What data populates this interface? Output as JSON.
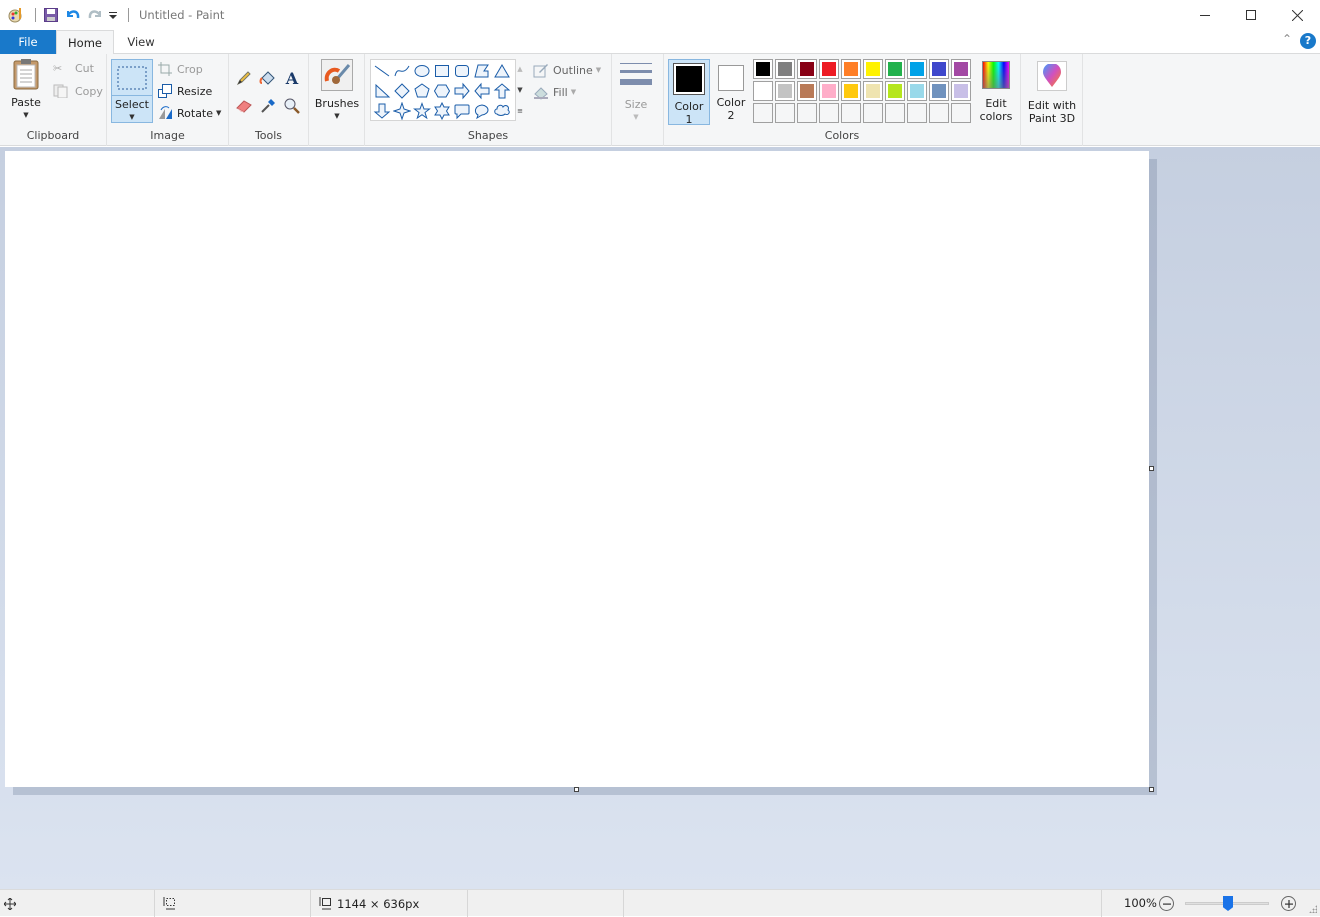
{
  "window": {
    "title": "Untitled - Paint",
    "controls": {
      "minimize": "minimize-icon",
      "maximize": "maximize-icon",
      "close": "close-icon"
    }
  },
  "quick_access": [
    "paint-app-icon",
    "save-icon",
    "undo-icon",
    "redo-icon",
    "customize-dropdown-icon"
  ],
  "tabs": [
    {
      "label": "File",
      "active": false
    },
    {
      "label": "Home",
      "active": true
    },
    {
      "label": "View",
      "active": false
    }
  ],
  "ribbon": {
    "clipboard": {
      "label": "Clipboard",
      "paste": "Paste",
      "cut": "Cut",
      "copy": "Copy"
    },
    "image": {
      "label": "Image",
      "select": "Select",
      "crop": "Crop",
      "resize": "Resize",
      "rotate": "Rotate"
    },
    "tools": {
      "label": "Tools",
      "items": [
        "pencil",
        "fill",
        "text",
        "eraser",
        "color-picker",
        "magnifier"
      ]
    },
    "brushes": {
      "label": "Brushes"
    },
    "shapes": {
      "label": "Shapes",
      "items": [
        "line",
        "curve",
        "oval",
        "rectangle",
        "rounded-rectangle",
        "polygon",
        "triangle",
        "right-triangle",
        "diamond",
        "pentagon",
        "hexagon",
        "right-arrow",
        "left-arrow",
        "up-arrow",
        "down-arrow",
        "four-point-star",
        "five-point-star",
        "six-point-star",
        "rounded-callout",
        "oval-callout",
        "cloud-callout"
      ],
      "outline": "Outline",
      "fill": "Fill"
    },
    "size": {
      "label": "Size"
    },
    "colors": {
      "label": "Colors",
      "color1": {
        "label_line1": "Color",
        "label_line2": "1",
        "value": "#000000"
      },
      "color2": {
        "label_line1": "Color",
        "label_line2": "2",
        "value": "#ffffff"
      },
      "palette_row1": [
        "#000000",
        "#7f7f7f",
        "#880015",
        "#ed1c24",
        "#ff7f27",
        "#fff200",
        "#22b14c",
        "#00a2e8",
        "#3f48cc",
        "#a349a4"
      ],
      "palette_row2": [
        "#ffffff",
        "#c3c3c3",
        "#b97a57",
        "#ffaec9",
        "#ffc90e",
        "#efe4b0",
        "#b5e61d",
        "#99d9ea",
        "#7092be",
        "#c8bfe7"
      ],
      "palette_row3": [
        "",
        "",
        "",
        "",
        "",
        "",
        "",
        "",
        "",
        ""
      ],
      "edit_colors_line1": "Edit",
      "edit_colors_line2": "colors"
    },
    "paint3d": {
      "line1": "Edit with",
      "line2": "Paint 3D"
    }
  },
  "status": {
    "canvas_size": "1144 × 636px",
    "zoom": "100%",
    "zoom_fraction": 0.5
  }
}
